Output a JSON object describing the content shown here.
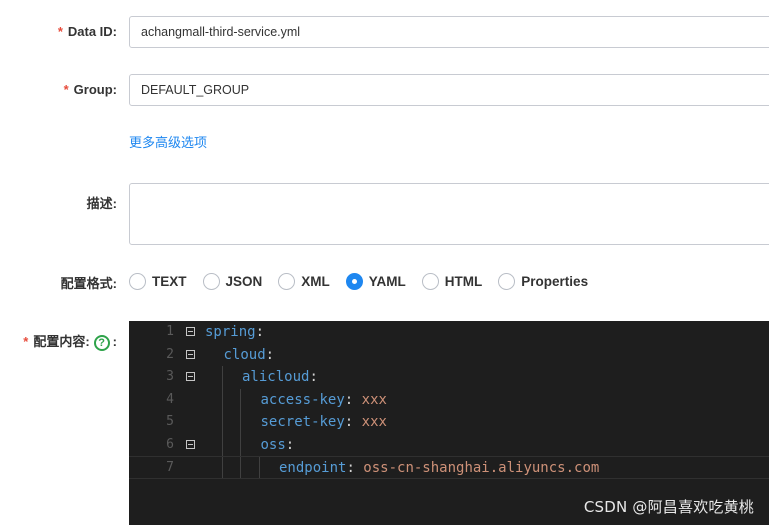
{
  "form": {
    "data_id": {
      "required_mark": "*",
      "label": "Data ID:",
      "value": "achangmall-third-service.yml"
    },
    "group": {
      "required_mark": "*",
      "label": "Group:",
      "value": "DEFAULT_GROUP"
    },
    "advanced_link": "更多高级选项",
    "description": {
      "label": "描述:",
      "value": ""
    },
    "format": {
      "label": "配置格式:",
      "options": [
        {
          "label": "TEXT",
          "checked": false
        },
        {
          "label": "JSON",
          "checked": false
        },
        {
          "label": "XML",
          "checked": false
        },
        {
          "label": "YAML",
          "checked": true
        },
        {
          "label": "HTML",
          "checked": false
        },
        {
          "label": "Properties",
          "checked": false
        }
      ]
    },
    "content": {
      "required_mark": "*",
      "label": "配置内容:",
      "help_icon": "help-circle-icon",
      "help_glyph": "?",
      "suffix": ":"
    }
  },
  "editor": {
    "lines": [
      {
        "number": "1",
        "key": "spring",
        "sep": ":",
        "value": "",
        "indent": 0,
        "foldable": true
      },
      {
        "number": "2",
        "key": "cloud",
        "sep": ":",
        "value": "",
        "indent": 1,
        "foldable": true
      },
      {
        "number": "3",
        "key": "alicloud",
        "sep": ":",
        "value": "",
        "indent": 2,
        "foldable": true
      },
      {
        "number": "4",
        "key": "access-key",
        "sep": ": ",
        "value": "xxx",
        "indent": 3,
        "foldable": false
      },
      {
        "number": "5",
        "key": "secret-key",
        "sep": ": ",
        "value": "xxx",
        "indent": 3,
        "foldable": false
      },
      {
        "number": "6",
        "key": "oss",
        "sep": ":",
        "value": "",
        "indent": 3,
        "foldable": true
      },
      {
        "number": "7",
        "key": "endpoint",
        "sep": ": ",
        "value": "oss-cn-shanghai.aliyuncs.com",
        "indent": 4,
        "foldable": false
      }
    ]
  },
  "watermark": "CSDN @阿昌喜欢吃黄桃",
  "colors": {
    "accent": "#1e87f0",
    "required": "#e74c3c",
    "help": "#2ea34a",
    "editor_bg": "#1e1e1e",
    "yaml_key": "#569cd6",
    "yaml_value": "#ce9178"
  }
}
